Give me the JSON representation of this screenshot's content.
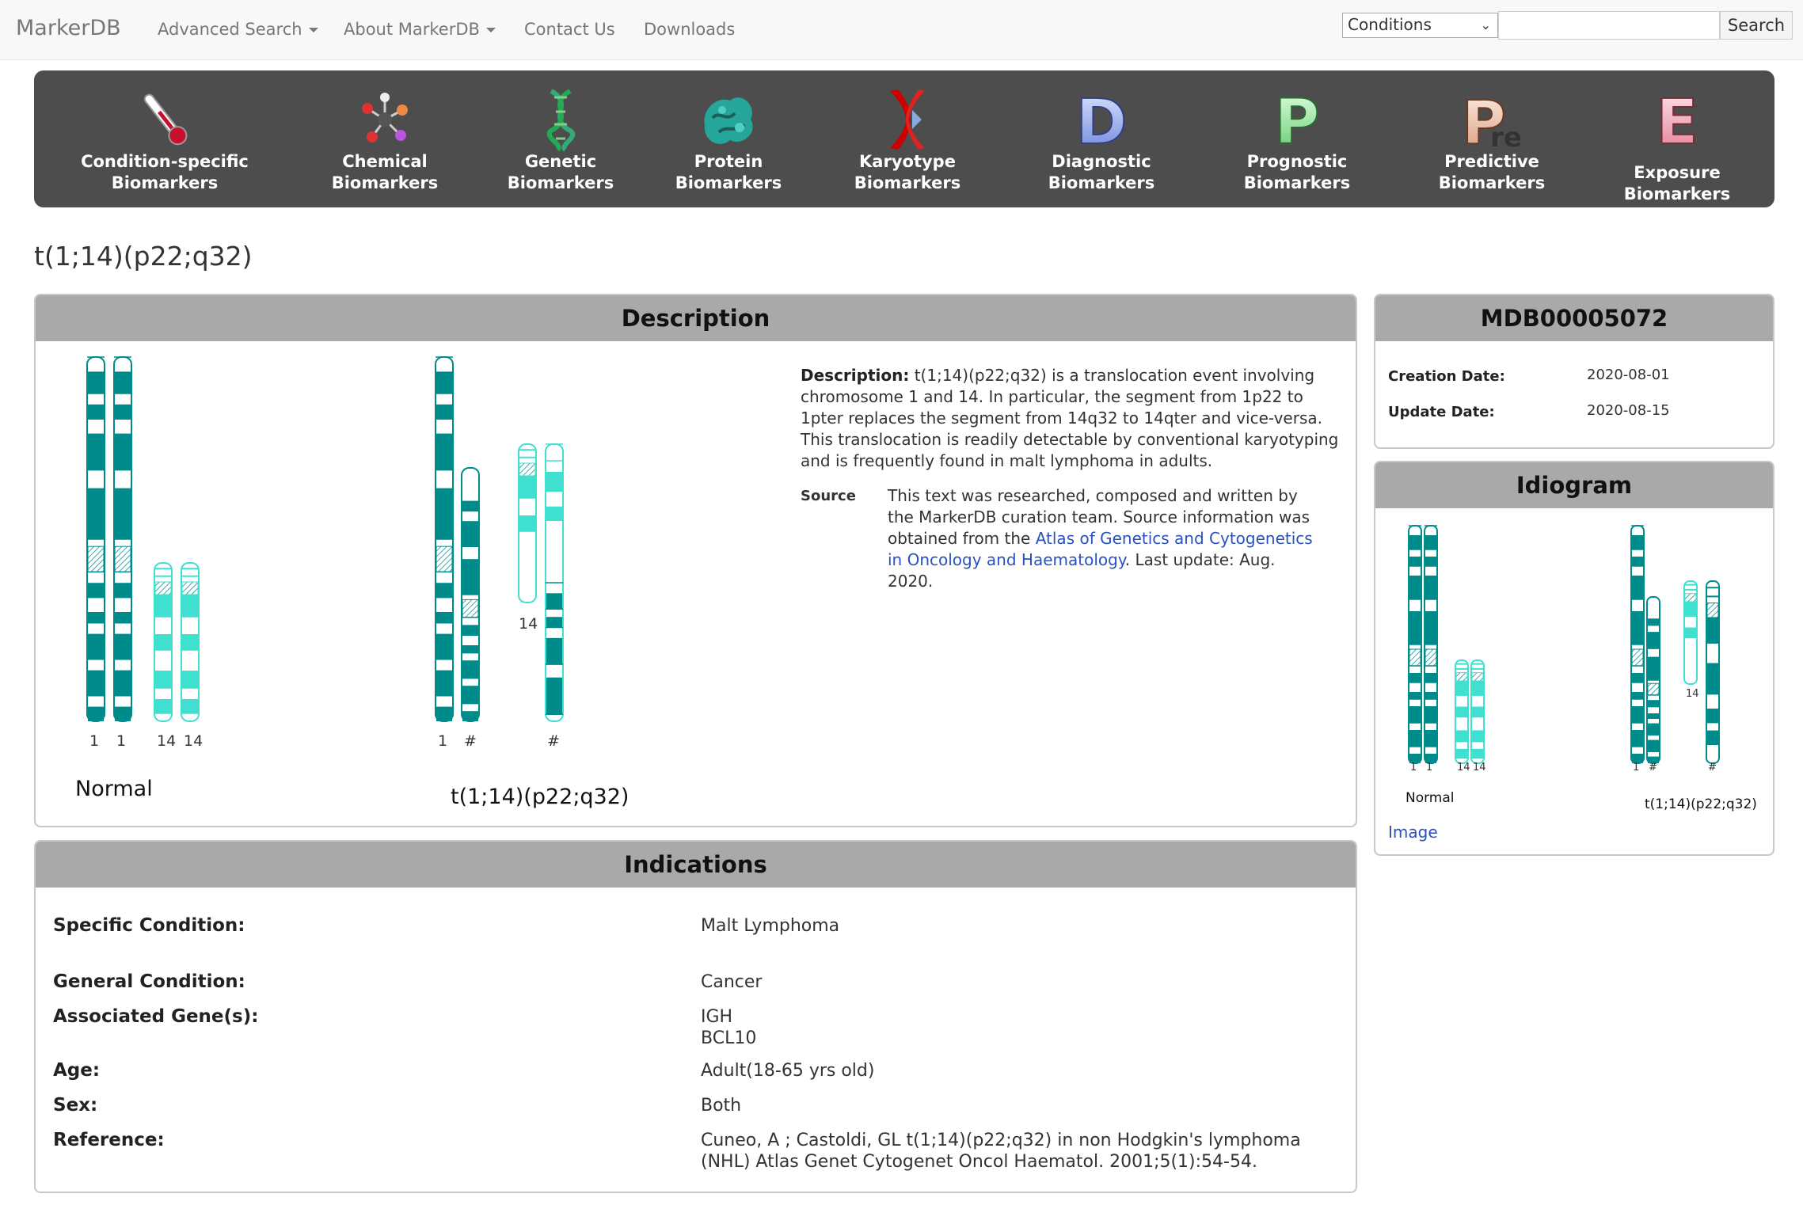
{
  "navbar": {
    "brand": "MarkerDB",
    "items": [
      "Advanced Search",
      "About MarkerDB",
      "Contact Us",
      "Downloads"
    ],
    "search": {
      "select_value": "Conditions",
      "input_value": "",
      "button_label": "Search"
    }
  },
  "categories": [
    {
      "line1": "Condition-specific",
      "line2": "Biomarkers",
      "icon": "thermometer-icon"
    },
    {
      "line1": "Chemical",
      "line2": "Biomarkers",
      "icon": "molecule-icon"
    },
    {
      "line1": "Genetic",
      "line2": "Biomarkers",
      "icon": "dna-icon"
    },
    {
      "line1": "Protein",
      "line2": "Biomarkers",
      "icon": "protein-icon"
    },
    {
      "line1": "Karyotype",
      "line2": "Biomarkers",
      "icon": "chromosome-icon"
    },
    {
      "line1": "Diagnostic",
      "line2": "Biomarkers",
      "icon": "letter-d-icon"
    },
    {
      "line1": "Prognostic",
      "line2": "Biomarkers",
      "icon": "letter-p-icon"
    },
    {
      "line1": "Predictive",
      "line2": "Biomarkers",
      "icon": "letters-pre-icon"
    },
    {
      "line1": "Exposure Biomarkers",
      "line2": "",
      "icon": "letter-e-icon"
    }
  ],
  "page_title": "t(1;14)(p22;q32)",
  "description": {
    "heading": "Description",
    "label": "Description:",
    "text": "t(1;14)(p22;q32) is a translocation event involving chromosome 1 and 14. In particular, the segment from 1p22 to 1pter replaces the segment from 14q32 to 14qter and vice-versa. This translocation is readily detectable by conventional karyotyping and is frequently found in malt lymphoma in adults.",
    "source_label": "Source",
    "source_text_pre": "This text was researched, composed and written by the MarkerDB curation team. Source information was obtained from the ",
    "source_link": "Atlas of Genetics and Cytogenetics in Oncology and Haematology",
    "source_text_post": ". Last update: Aug. 2020.",
    "karyotype": {
      "normal_labels": [
        "1",
        "1",
        "14",
        "14"
      ],
      "normal_caption": "Normal",
      "abnormal_labels": [
        "1",
        "#",
        "14",
        "#"
      ],
      "abnormal_caption": "t(1;14)(p22;q32)"
    }
  },
  "indications": {
    "heading": "Indications",
    "rows": [
      {
        "label": "Specific Condition:",
        "values": [
          "Malt Lymphoma"
        ],
        "link": true
      },
      {
        "label": "General Condition:",
        "values": [
          "Cancer"
        ],
        "link": true
      },
      {
        "label": "Associated Gene(s):",
        "values": [
          "IGH",
          "BCL10"
        ],
        "link": true
      },
      {
        "label": "Age:",
        "values": [
          "Adult(18-65 yrs old)"
        ],
        "link": false
      },
      {
        "label": "Sex:",
        "values": [
          "Both"
        ],
        "link": false
      },
      {
        "label": "Reference:",
        "values": [
          "Cuneo, A ; Castoldi, GL t(1;14)(p22;q32) in non Hodgkin's lymphoma (NHL) Atlas Genet Cytogenet Oncol Haematol. 2001;5(1):54-54."
        ],
        "link": false
      }
    ]
  },
  "record": {
    "id": "MDB00005072",
    "creation_label": "Creation Date:",
    "creation_date": "2020-08-01",
    "update_label": "Update Date:",
    "update_date": "2020-08-15"
  },
  "idiogram": {
    "heading": "Idiogram",
    "image_link": "Image"
  },
  "colors": {
    "chr1": "#008b8b",
    "chr14": "#40e0d0",
    "banner": "#4d4d4d",
    "panel_head": "#a9a9a9",
    "link": "#2a52be"
  }
}
